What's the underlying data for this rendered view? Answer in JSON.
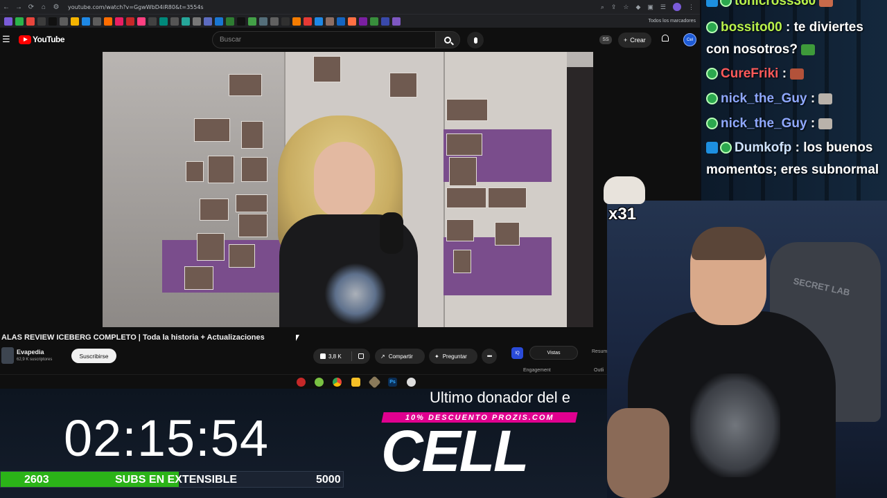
{
  "browser": {
    "url": "youtube.com/watch?v=GgwWbD4iR80&t=3554s",
    "bookmarks_label": "Todos los marcadores"
  },
  "youtube": {
    "brand": "YouTube",
    "search_placeholder": "Buscar",
    "ss_badge": "SS",
    "create_label": "Crear",
    "avatar_text": "Cel"
  },
  "video": {
    "title": "ALAS REVIEW ICEBERG COMPLETO | Toda la historia + Actualizaciones",
    "channel_name": "Evapedia",
    "channel_subs": "62,9 K suscriptores",
    "subscribe_label": "Suscribirse",
    "likes": "3,8 K",
    "share_label": "Compartir",
    "ask_label": "Preguntar"
  },
  "extension_panel": {
    "logo_text": "IQ",
    "tab_active": "Vistas",
    "tab_other": "Resum",
    "label_engagement": "Engagement",
    "label_outliers": "Outli"
  },
  "chat": {
    "messages": [
      {
        "user": "tonicross360",
        "text": "",
        "color": "#b9f24b"
      },
      {
        "user": "bossito00",
        "text": ": te diviertes con nosotros?",
        "color": "#b9f24b"
      },
      {
        "user": "CureFriki",
        "text": ":",
        "color": "#ff5a5a"
      },
      {
        "user": "nick_the_Guy",
        "text": ":",
        "color": "#8fa8ff"
      },
      {
        "user": "nick_the_Guy",
        "text": ":",
        "color": "#8fa8ff"
      },
      {
        "user": "Dumkofp",
        "text": ": los buenos momentos; eres subnormal",
        "color": "#cfe3ff"
      }
    ]
  },
  "emote_counter": "x31",
  "overlay": {
    "timer": "02:15:54",
    "subs_current": "2603",
    "subs_label": "SUBS EN EXTENSIBLE",
    "subs_goal": "5000",
    "subs_progress": 0.52,
    "donor_title": "Ultimo donador del e",
    "sponsor": "10% DESCUENTO PROZIS.COM",
    "donor_name": "CELL"
  },
  "chair_logo": "SECRET LAB",
  "colors": {
    "accent_youtube": "#ff0000",
    "subs_bar": "#2bb318",
    "sponsor_banner": "#e0008f"
  }
}
